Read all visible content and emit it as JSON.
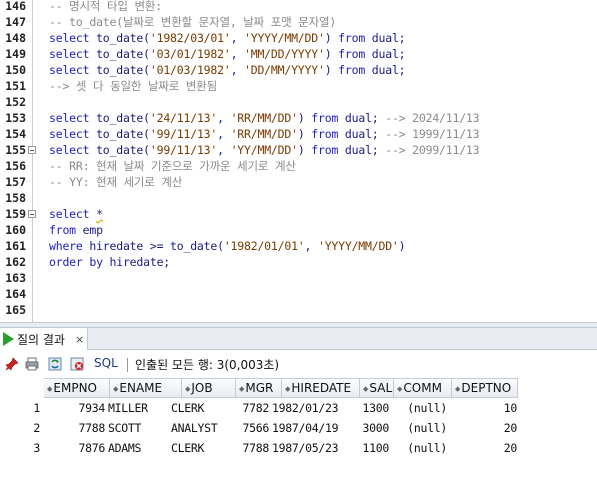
{
  "editor": {
    "lines": [
      {
        "num": "146",
        "tokens": [
          {
            "t": "-- 명시적 타입 변환:",
            "c": "cmt"
          }
        ]
      },
      {
        "num": "147",
        "tokens": [
          {
            "t": "-- to_date(날짜로 변환할 문자열, 날짜 포맷 문자열)",
            "c": "cmt"
          }
        ]
      },
      {
        "num": "148",
        "tokens": [
          {
            "t": "select ",
            "c": "kw"
          },
          {
            "t": "to_date(",
            "c": "plain"
          },
          {
            "t": "'1982/03/01'",
            "c": "str"
          },
          {
            "t": ", ",
            "c": "plain"
          },
          {
            "t": "'YYYY/MM/DD'",
            "c": "str"
          },
          {
            "t": ") ",
            "c": "plain"
          },
          {
            "t": "from ",
            "c": "kw"
          },
          {
            "t": "dual;",
            "c": "plain"
          }
        ]
      },
      {
        "num": "149",
        "tokens": [
          {
            "t": "select ",
            "c": "kw"
          },
          {
            "t": "to_date(",
            "c": "plain"
          },
          {
            "t": "'03/01/1982'",
            "c": "str"
          },
          {
            "t": ", ",
            "c": "plain"
          },
          {
            "t": "'MM/DD/YYYY'",
            "c": "str"
          },
          {
            "t": ") ",
            "c": "plain"
          },
          {
            "t": "from ",
            "c": "kw"
          },
          {
            "t": "dual;",
            "c": "plain"
          }
        ]
      },
      {
        "num": "150",
        "tokens": [
          {
            "t": "select ",
            "c": "kw"
          },
          {
            "t": "to_date(",
            "c": "plain"
          },
          {
            "t": "'01/03/1982'",
            "c": "str"
          },
          {
            "t": ", ",
            "c": "plain"
          },
          {
            "t": "'DD/MM/YYYY'",
            "c": "str"
          },
          {
            "t": ") ",
            "c": "plain"
          },
          {
            "t": "from ",
            "c": "kw"
          },
          {
            "t": "dual;",
            "c": "plain"
          }
        ]
      },
      {
        "num": "151",
        "tokens": [
          {
            "t": "--> 셋 다 동일한 날짜로 변환됨",
            "c": "cmt"
          }
        ]
      },
      {
        "num": "152",
        "tokens": []
      },
      {
        "num": "153",
        "tokens": [
          {
            "t": "select ",
            "c": "kw"
          },
          {
            "t": "to_date(",
            "c": "plain"
          },
          {
            "t": "'24/11/13'",
            "c": "str"
          },
          {
            "t": ", ",
            "c": "plain"
          },
          {
            "t": "'RR/MM/DD'",
            "c": "str"
          },
          {
            "t": ") ",
            "c": "plain"
          },
          {
            "t": "from ",
            "c": "kw"
          },
          {
            "t": "dual; ",
            "c": "plain"
          },
          {
            "t": "--> 2024/11/13",
            "c": "cmt"
          }
        ]
      },
      {
        "num": "154",
        "tokens": [
          {
            "t": "select ",
            "c": "kw"
          },
          {
            "t": "to_date(",
            "c": "plain"
          },
          {
            "t": "'99/11/13'",
            "c": "str"
          },
          {
            "t": ", ",
            "c": "plain"
          },
          {
            "t": "'RR/MM/DD'",
            "c": "str"
          },
          {
            "t": ") ",
            "c": "plain"
          },
          {
            "t": "from ",
            "c": "kw"
          },
          {
            "t": "dual; ",
            "c": "plain"
          },
          {
            "t": "--> 1999/11/13",
            "c": "cmt"
          }
        ]
      },
      {
        "num": "155",
        "fold": true,
        "tokens": [
          {
            "t": "select ",
            "c": "kw"
          },
          {
            "t": "to_date(",
            "c": "plain"
          },
          {
            "t": "'99/11/13'",
            "c": "str"
          },
          {
            "t": ", ",
            "c": "plain"
          },
          {
            "t": "'YY/MM/DD'",
            "c": "str"
          },
          {
            "t": ") ",
            "c": "plain"
          },
          {
            "t": "from ",
            "c": "kw"
          },
          {
            "t": "dual; ",
            "c": "plain"
          },
          {
            "t": "--> 2099/11/13",
            "c": "cmt"
          }
        ]
      },
      {
        "num": "156",
        "tokens": [
          {
            "t": "-- RR: 현재 날짜 기준으로 가까운 세기로 계산",
            "c": "cmt"
          }
        ]
      },
      {
        "num": "157",
        "tokens": [
          {
            "t": "-- YY: 현재 세기로 계산",
            "c": "cmt"
          }
        ]
      },
      {
        "num": "158",
        "tokens": []
      },
      {
        "num": "159",
        "fold": true,
        "tokens": [
          {
            "t": "select ",
            "c": "kw"
          },
          {
            "t": "*",
            "c": "plain squig"
          }
        ]
      },
      {
        "num": "160",
        "tokens": [
          {
            "t": "from ",
            "c": "kw"
          },
          {
            "t": "emp",
            "c": "plain"
          }
        ]
      },
      {
        "num": "161",
        "tokens": [
          {
            "t": "where ",
            "c": "kw"
          },
          {
            "t": "hiredate >= to_date(",
            "c": "plain"
          },
          {
            "t": "'1982/01/01'",
            "c": "str"
          },
          {
            "t": ", ",
            "c": "plain"
          },
          {
            "t": "'YYYY/MM/DD'",
            "c": "str"
          },
          {
            "t": ")",
            "c": "plain"
          }
        ]
      },
      {
        "num": "162",
        "tokens": [
          {
            "t": "order by ",
            "c": "kw"
          },
          {
            "t": "hiredate;",
            "c": "plain"
          }
        ]
      },
      {
        "num": "163",
        "tokens": []
      },
      {
        "num": "164",
        "tokens": []
      },
      {
        "num": "165",
        "tokens": []
      }
    ]
  },
  "results": {
    "tab_label": "질의 결과",
    "tab_close": "×",
    "toolbar": {
      "sql_label": "SQL",
      "divider": "|",
      "status": "인출된 모든 행: 3(0,003초)"
    },
    "columns": [
      "EMPNO",
      "ENAME",
      "JOB",
      "MGR",
      "HIREDATE",
      "SAL",
      "COMM",
      "DEPTNO"
    ],
    "rows": [
      {
        "n": "1",
        "cells": [
          "7934",
          "MILLER",
          "CLERK",
          "7782",
          "1982/01/23",
          "1300",
          "(null)",
          "10"
        ]
      },
      {
        "n": "2",
        "cells": [
          "7788",
          "SCOTT",
          "ANALYST",
          "7566",
          "1987/04/19",
          "3000",
          "(null)",
          "20"
        ]
      },
      {
        "n": "3",
        "cells": [
          "7876",
          "ADAMS",
          "CLERK",
          "7788",
          "1987/05/23",
          "1100",
          "(null)",
          "20"
        ]
      }
    ]
  },
  "colors": {
    "keyword": "#2020c0",
    "string": "#7a3a00",
    "comment": "#8a8a8a",
    "run_green": "#2aa02a"
  }
}
